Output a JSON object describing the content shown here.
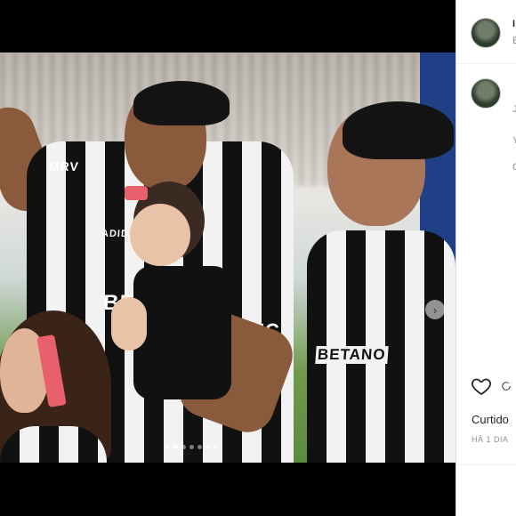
{
  "post": {
    "photo_brands": {
      "shirt_sponsor_left": "ADIDAS",
      "shirt_text_mrv": "MRV",
      "betano": "BETANO",
      "betano_partial": "BE",
      "number_partial": "EC"
    },
    "carousel": {
      "count": 7,
      "active_index": 1
    }
  },
  "sidebar": {
    "header_username_partial": "I",
    "header_subtitle_partial": "E",
    "comment_username_partial": "",
    "comment_lines": [
      "J",
      "Y",
      "C"
    ],
    "likes_label": "Curtido",
    "time_label": "HÁ 1 DIA"
  },
  "icons": {
    "like": "heart-icon",
    "comment": "comment-icon",
    "next": "chevron-right-icon"
  }
}
